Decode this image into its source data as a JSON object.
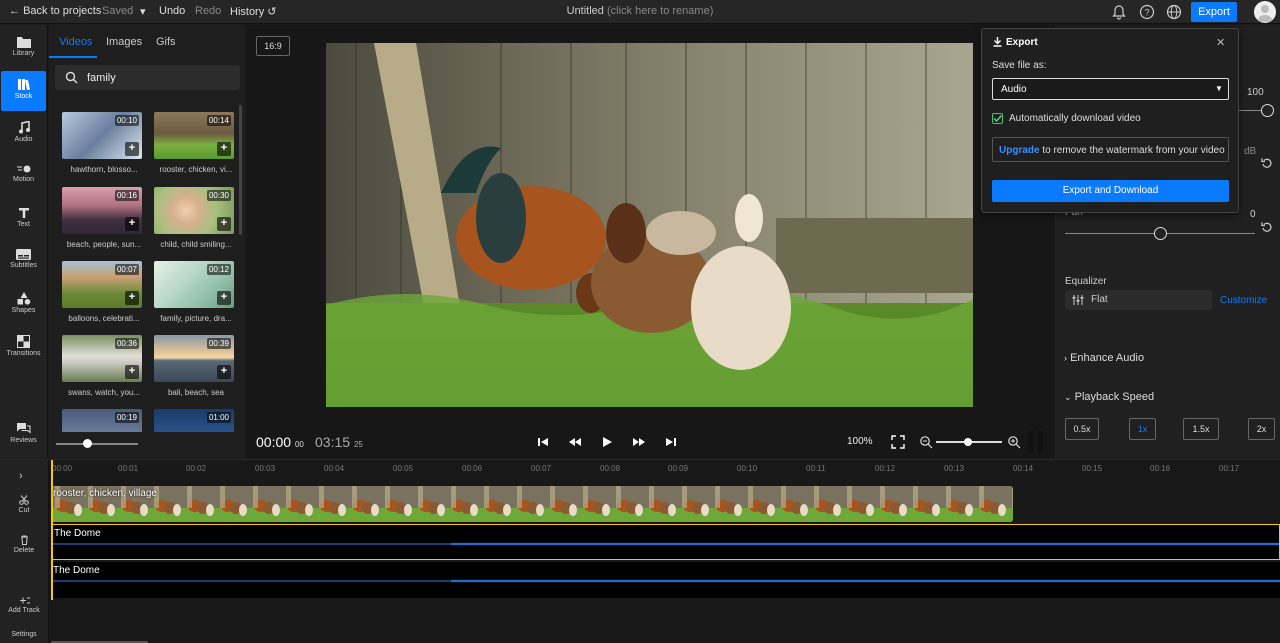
{
  "topbar": {
    "back_label": "Back to projects",
    "saved_label": "Saved",
    "undo_label": "Undo",
    "redo_label": "Redo",
    "history_label": "History",
    "project_title": "Untitled",
    "rename_hint": "(click here to rename)",
    "export_label": "Export"
  },
  "rail": {
    "items": [
      {
        "label": "Library",
        "icon": "folder-icon"
      },
      {
        "label": "Stock",
        "icon": "books-icon"
      },
      {
        "label": "Audio",
        "icon": "music-note-icon"
      },
      {
        "label": "Motion",
        "icon": "motion-icon"
      },
      {
        "label": "Text",
        "icon": "text-icon"
      },
      {
        "label": "Subtitles",
        "icon": "subtitles-icon"
      },
      {
        "label": "Shapes",
        "icon": "shapes-icon"
      },
      {
        "label": "Transitions",
        "icon": "transitions-icon"
      },
      {
        "label": "Reviews",
        "icon": "chat-icon"
      }
    ]
  },
  "media": {
    "tabs": [
      "Videos",
      "Images",
      "Gifs"
    ],
    "search_value": "family",
    "thumbs": [
      {
        "duration": "00:10",
        "label": "hawthorn, blosso...",
        "color": "#8a9bb5"
      },
      {
        "duration": "00:14",
        "label": "rooster, chicken, vi...",
        "color": "#6a8a3e"
      },
      {
        "duration": "00:16",
        "label": "beach, people, sun...",
        "color": "#b37a8a"
      },
      {
        "duration": "00:30",
        "label": "child, child smiling...",
        "color": "#9ab07a"
      },
      {
        "duration": "00:07",
        "label": "balloons, celebrati...",
        "color": "#7c9a5a"
      },
      {
        "duration": "00:12",
        "label": "family, picture, dra...",
        "color": "#a8c8b8"
      },
      {
        "duration": "00:36",
        "label": "swans, watch, you...",
        "color": "#7a8f5e"
      },
      {
        "duration": "00:39",
        "label": "bali, beach, sea",
        "color": "#c89a6a"
      },
      {
        "duration": "00:19",
        "label": "",
        "color": "#5a6a8a"
      },
      {
        "duration": "01:00",
        "label": "",
        "color": "#3a5a8a"
      }
    ]
  },
  "preview": {
    "aspect_ratio": "16:9",
    "current_time": "00:00",
    "current_frame": "00",
    "total_time": "03:15",
    "total_frame": "25",
    "zoom": "100%"
  },
  "right_panel": {
    "volume_value": "100",
    "db_label": "dB",
    "pan_label": "Pan",
    "pan_value": "0",
    "equalizer_label": "Equalizer",
    "equalizer_value": "Flat",
    "customize_label": "Customize",
    "enhance_label": "Enhance Audio",
    "playback_label": "Playback Speed",
    "speeds": [
      "0.5x",
      "1x",
      "1.5x",
      "2x"
    ],
    "selected_speed": "1x"
  },
  "export_popover": {
    "title": "Export",
    "save_as_label": "Save file as:",
    "format_value": "Audio",
    "auto_download_label": "Automatically download video",
    "upgrade_link": "Upgrade",
    "upgrade_text": " to remove the watermark from your video",
    "action_label": "Export and Download"
  },
  "timeline": {
    "rail": [
      "Cut",
      "Delete",
      "Add Track",
      "Settings"
    ],
    "ticks": [
      "00:00",
      "00:01",
      "00:02",
      "00:03",
      "00:04",
      "00:05",
      "00:06",
      "00:07",
      "00:08",
      "00:09",
      "00:10",
      "00:11",
      "00:12",
      "00:13",
      "00:14",
      "00:15",
      "00:16",
      "00:17"
    ],
    "video_clip_label": "rooster, chicken, village",
    "audio_tracks": [
      "The Dome",
      "The Dome"
    ]
  },
  "colors": {
    "accent": "#0a7bff",
    "selection": "#f5c518",
    "check_green": "#3ec46d",
    "waveform": "#2f7cf0"
  }
}
